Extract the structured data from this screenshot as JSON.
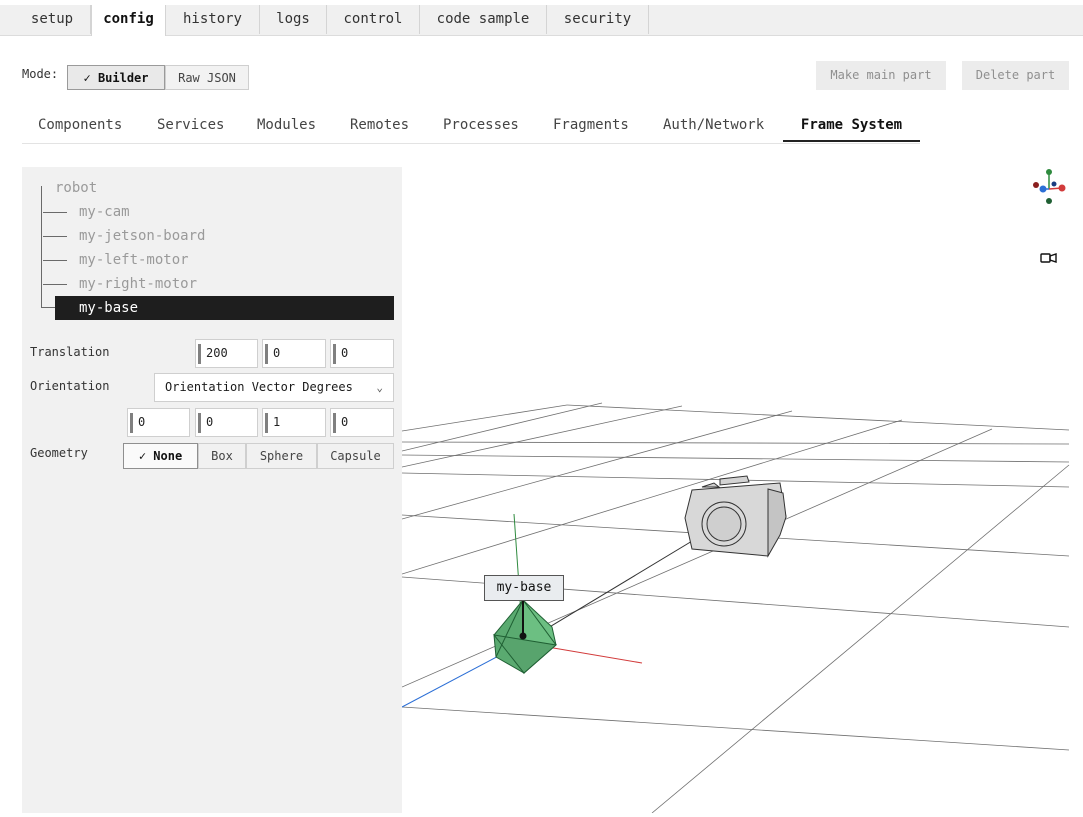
{
  "top_tabs": [
    "setup",
    "config",
    "history",
    "logs",
    "control",
    "code sample",
    "security"
  ],
  "mode": {
    "label": "Mode:",
    "builder": "Builder",
    "raw_json": "Raw JSON",
    "make_main_part": "Make main part",
    "delete_part": "Delete part"
  },
  "sub_tabs": [
    "Components",
    "Services",
    "Modules",
    "Remotes",
    "Processes",
    "Fragments",
    "Auth/Network",
    "Frame System"
  ],
  "tree": {
    "root": "robot",
    "items": [
      "my-cam",
      "my-jetson-board",
      "my-left-motor",
      "my-right-motor",
      "my-base"
    ],
    "selected": "my-base"
  },
  "frame": {
    "translation_label": "Translation",
    "translation": [
      "200",
      "0",
      "0"
    ],
    "orientation_label": "Orientation",
    "orientation_type": "Orientation Vector Degrees",
    "orientation": [
      "0",
      "0",
      "1",
      "0"
    ],
    "geometry_label": "Geometry",
    "geometry_options": [
      "None",
      "Box",
      "Sphere",
      "Capsule"
    ],
    "geometry_selected": "None"
  },
  "viewport": {
    "selected_label": "my-base",
    "base_color": "#5aaa70",
    "axis_colors": {
      "x": "#d23b3b",
      "y": "#2e8a3e",
      "z": "#2c6fd6"
    },
    "camera_icon": "video-camera-icon"
  }
}
